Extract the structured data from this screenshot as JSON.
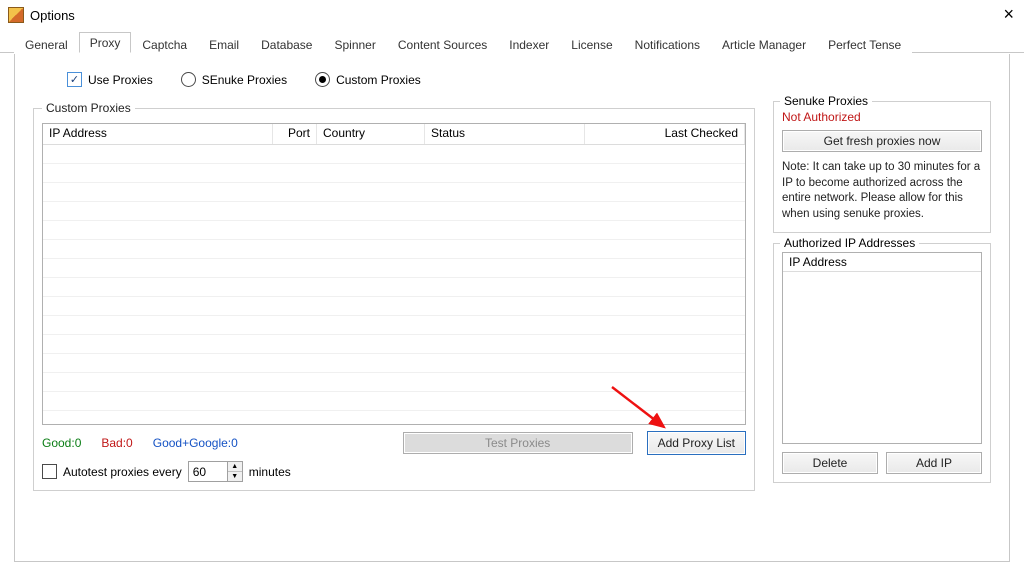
{
  "window": {
    "title": "Options"
  },
  "tabs": [
    "General",
    "Proxy",
    "Captcha",
    "Email",
    "Database",
    "Spinner",
    "Content Sources",
    "Indexer",
    "License",
    "Notifications",
    "Article Manager",
    "Perfect Tense"
  ],
  "active_tab": "Proxy",
  "opts": {
    "use_proxies": "Use Proxies",
    "senuke_proxies": "SEnuke Proxies",
    "custom_proxies": "Custom Proxies"
  },
  "custom_group": "Custom Proxies",
  "grid_headers": {
    "ip": "IP Address",
    "port": "Port",
    "country": "Country",
    "status": "Status",
    "last": "Last Checked"
  },
  "stats": {
    "good": "Good:0",
    "bad": "Bad:0",
    "gg": "Good+Google:0"
  },
  "buttons": {
    "test": "Test Proxies",
    "add_list": "Add Proxy List",
    "get_fresh": "Get fresh proxies now",
    "delete": "Delete",
    "add_ip": "Add IP"
  },
  "autotest": {
    "label_pre": "Autotest proxies every",
    "value": "60",
    "label_post": "minutes"
  },
  "senuke": {
    "legend": "Senuke Proxies",
    "not_auth": "Not Authorized",
    "note": "Note: It can take up to 30 minutes for a IP to become authorized across the entire network. Please allow for this when using senuke proxies."
  },
  "auth": {
    "legend": "Authorized IP Addresses",
    "header": "IP Address"
  }
}
